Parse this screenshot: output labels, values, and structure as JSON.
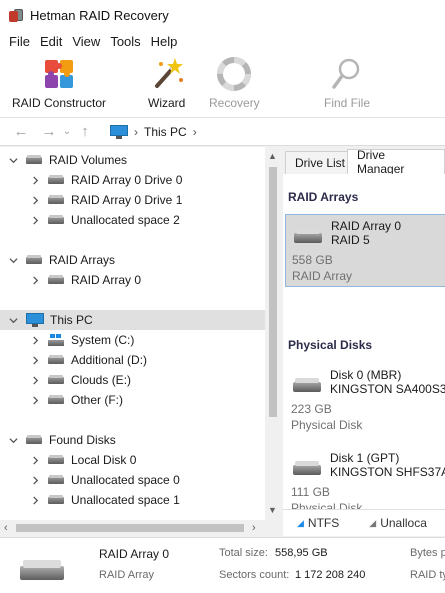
{
  "window": {
    "title": "Hetman RAID Recovery"
  },
  "menu": [
    "File",
    "Edit",
    "View",
    "Tools",
    "Help"
  ],
  "toolbar": {
    "raid_constructor": "RAID Constructor",
    "wizard": "Wizard",
    "recovery": "Recovery",
    "find_file": "Find File"
  },
  "nav": {
    "path": "This PC"
  },
  "tree": {
    "raid_volumes": {
      "label": "RAID Volumes",
      "items": [
        "RAID Array 0 Drive 0",
        "RAID Array 0 Drive 1",
        "Unallocated space 2"
      ]
    },
    "raid_arrays": {
      "label": "RAID Arrays",
      "items": [
        "RAID Array 0"
      ]
    },
    "this_pc": {
      "label": "This PC",
      "items": [
        "System (C:)",
        "Additional (D:)",
        "Clouds (E:)",
        "Other (F:)"
      ]
    },
    "found_disks": {
      "label": "Found Disks",
      "items": [
        "Local Disk 0",
        "Unallocated space 0",
        "Unallocated space 1"
      ]
    }
  },
  "tabs": {
    "drive_list": "Drive List",
    "drive_manager": "Drive Manager"
  },
  "drive_manager": {
    "raid_arrays_title": "RAID Arrays",
    "raid_array": {
      "name": "RAID Array 0",
      "level": "RAID 5",
      "size": "558 GB",
      "type": "RAID Array"
    },
    "physical_disks_title": "Physical Disks",
    "disks": [
      {
        "name": "Disk 0 (MBR)",
        "model": "KINGSTON SA400S3",
        "size": "223 GB",
        "type": "Physical Disk"
      },
      {
        "name": "Disk 1 (GPT)",
        "model": "KINGSTON SHFS37A",
        "size": "111 GB",
        "type": "Physical Disk"
      }
    ]
  },
  "legend": {
    "ntfs": "NTFS",
    "unallocated": "Unalloca"
  },
  "status": {
    "name": "RAID Array 0",
    "type": "RAID Array",
    "total_size_label": "Total size:",
    "total_size": "558,95 GB",
    "sectors_label": "Sectors count:",
    "sectors": "1 172 208 240",
    "bytes_label": "Bytes p",
    "raid_type_label": "RAID ty"
  }
}
